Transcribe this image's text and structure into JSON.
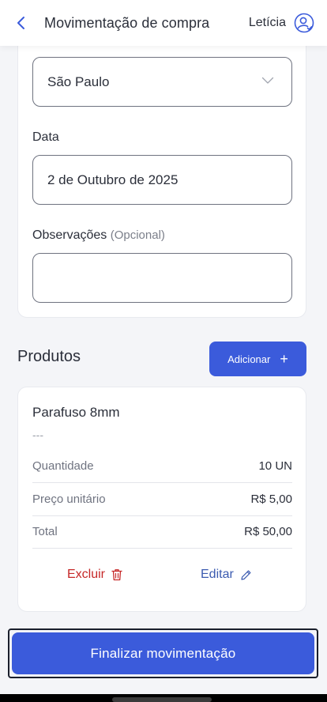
{
  "header": {
    "title": "Movimentação de compra",
    "user_name": "Letícia",
    "back_icon": "chevron-left-icon",
    "avatar_icon": "user-circle-icon"
  },
  "form": {
    "location_value": "São Paulo",
    "date_label": "Data",
    "date_value": "2 de Outubro de 2025",
    "notes_label": "Observações",
    "notes_optional": "(Opcional)",
    "notes_value": ""
  },
  "products": {
    "section_title": "Produtos",
    "add_label": "Adicionar",
    "add_icon": "+",
    "items": [
      {
        "name": "Parafuso 8mm",
        "description": "---",
        "quantity_label": "Quantidade",
        "quantity_value": "10 UN",
        "unit_price_label": "Preço unitário",
        "unit_price_value": "R$ 5,00",
        "total_label": "Total",
        "total_value": "R$ 50,00",
        "delete_label": "Excluir",
        "edit_label": "Editar"
      }
    ]
  },
  "footer": {
    "finalize_label": "Finalizar movimentação"
  },
  "colors": {
    "primary": "#3b5bdb",
    "danger": "#c62828",
    "link": "#3b5bb0"
  }
}
